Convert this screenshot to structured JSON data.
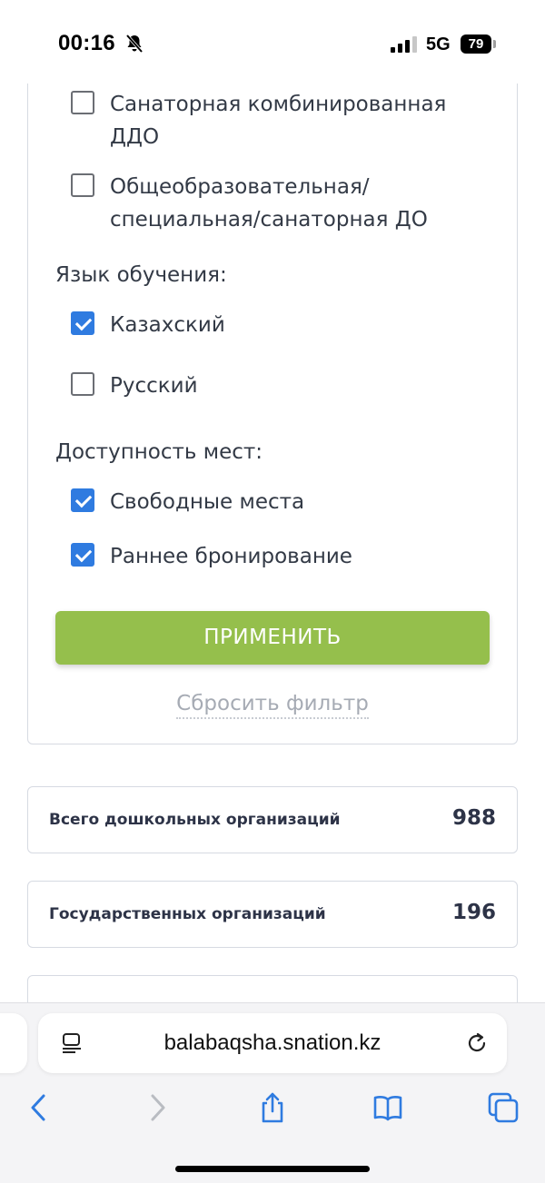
{
  "status_bar": {
    "time": "00:16",
    "network": "5G",
    "battery": "79"
  },
  "filters": {
    "type_options": [
      {
        "label": "Санаторная комбинированная ДДО",
        "checked": false
      },
      {
        "label": "Общеобразовательная/ специальная/санаторная ДО",
        "checked": false
      }
    ],
    "language_label": "Язык обучения:",
    "language_options": [
      {
        "label": "Казахский",
        "checked": true
      },
      {
        "label": "Русский",
        "checked": false
      }
    ],
    "availability_label": "Доступность мест:",
    "availability_options": [
      {
        "label": "Свободные места",
        "checked": true
      },
      {
        "label": "Раннее бронирование",
        "checked": true
      }
    ],
    "apply_label": "ПРИМЕНИТЬ",
    "reset_label": "Сбросить фильтр"
  },
  "stats": [
    {
      "label": "Всего дошкольных организаций",
      "value": "988"
    },
    {
      "label": "Государственных организаций",
      "value": "196"
    }
  ],
  "browser": {
    "url": "balabaqsha.snation.kz"
  },
  "colors": {
    "accent_green": "#95bf4c",
    "checkbox_blue": "#2f7be0"
  }
}
